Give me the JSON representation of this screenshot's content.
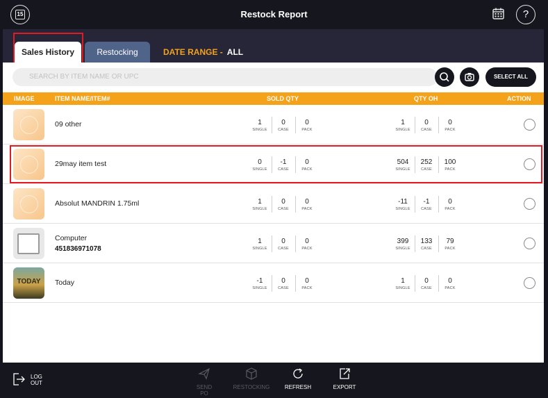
{
  "header": {
    "title": "Restock Report",
    "left_icon_text": "15"
  },
  "tabs": {
    "sales_history": "Sales History",
    "restocking": "Restocking",
    "date_range_label": "DATE RANGE -",
    "date_range_value": "ALL"
  },
  "search": {
    "placeholder": "SEARCH BY ITEM NAME OR UPC",
    "select_all": "SELECT ALL"
  },
  "table": {
    "columns": {
      "image": "IMAGE",
      "item": "ITEM NAME/ITEM#",
      "sold": "SOLD QTY",
      "qoh": "QTY OH",
      "action": "ACTION"
    },
    "sub_labels": {
      "single": "SINGLE",
      "case": "CASE",
      "pack": "PACK"
    },
    "rows": [
      {
        "name": "09 other",
        "number": "",
        "sold": [
          "1",
          "0",
          "0"
        ],
        "qoh": [
          "1",
          "0",
          "0"
        ]
      },
      {
        "name": "29may item test",
        "number": "",
        "sold": [
          "0",
          "-1",
          "0"
        ],
        "qoh": [
          "504",
          "252",
          "100"
        ]
      },
      {
        "name": "Absolut MANDRIN 1.75ml",
        "number": "",
        "sold": [
          "1",
          "0",
          "0"
        ],
        "qoh": [
          "-11",
          "-1",
          "0"
        ]
      },
      {
        "name": "Computer",
        "number": "451836971078",
        "sold": [
          "1",
          "0",
          "0"
        ],
        "qoh": [
          "399",
          "133",
          "79"
        ]
      },
      {
        "name": "Today",
        "number": "",
        "sold": [
          "-1",
          "0",
          "0"
        ],
        "qoh": [
          "1",
          "0",
          "0"
        ],
        "thumb_text": "TODAY"
      }
    ]
  },
  "footer": {
    "logout_line1": "LOG",
    "logout_line2": "OUT",
    "send_po_line1": "SEND",
    "send_po_line2": "PO",
    "restocking": "RESTOCKING",
    "refresh": "REFRESH",
    "export": "EXPORT"
  },
  "colors": {
    "accent": "#f5a21b",
    "header_bg": "#16161e",
    "tab_band": "#262638",
    "restocking_tab": "#50648a",
    "highlight": "#e01b24"
  }
}
